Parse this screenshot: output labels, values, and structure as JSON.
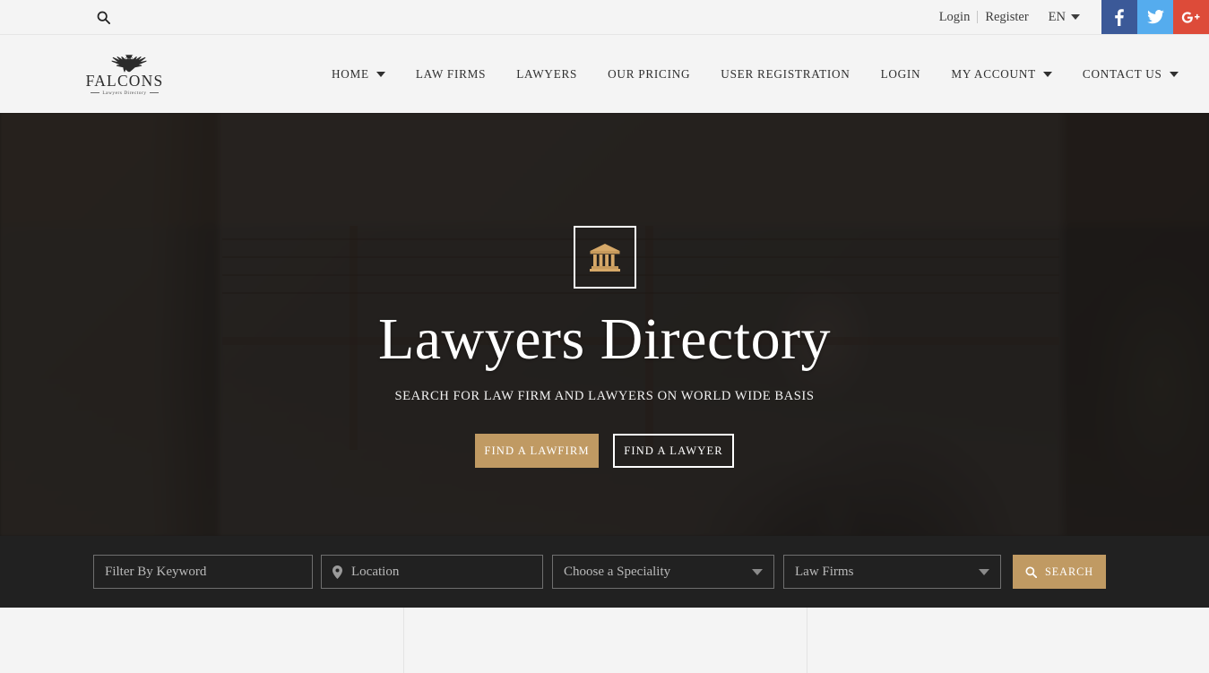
{
  "topbar": {
    "search_icon": "search-icon",
    "login_label": "Login",
    "register_label": "Register",
    "language_label": "EN",
    "social": [
      {
        "name": "facebook",
        "glyph": "f",
        "color": "#3b5998"
      },
      {
        "name": "twitter",
        "glyph": "t",
        "color": "#55acee"
      },
      {
        "name": "google-plus",
        "glyph": "G+",
        "color": "#dd4b39"
      }
    ]
  },
  "header": {
    "logo": {
      "name": "FALCONS",
      "tagline": "Lawyers Directory",
      "icon": "falcon-eagle-icon"
    },
    "nav": [
      {
        "label": "HOME",
        "has_dropdown": true
      },
      {
        "label": "LAW FIRMS",
        "has_dropdown": false
      },
      {
        "label": "LAWYERS",
        "has_dropdown": false
      },
      {
        "label": "OUR PRICING",
        "has_dropdown": false
      },
      {
        "label": "USER REGISTRATION",
        "has_dropdown": false
      },
      {
        "label": "LOGIN",
        "has_dropdown": false
      },
      {
        "label": "MY ACCOUNT",
        "has_dropdown": true
      },
      {
        "label": "CONTACT US",
        "has_dropdown": true
      }
    ]
  },
  "hero": {
    "icon": "bank-courthouse-icon",
    "title": "Lawyers Directory",
    "subtitle": "SEARCH FOR LAW FIRM AND LAWYERS ON WORLD WIDE BASIS",
    "primary_button": "FIND A LAWFIRM",
    "secondary_button": "FIND A LAWYER",
    "accent_color": "#c09a63",
    "overlay_color": "#141211"
  },
  "search": {
    "keyword_placeholder": "Filter By Keyword",
    "keyword_value": "",
    "location_placeholder": "Location",
    "location_value": "",
    "location_icon": "map-pin-icon",
    "speciality_selected": "Choose a Speciality",
    "type_selected": "Law Firms",
    "search_button": "SEARCH",
    "search_button_icon": "search-icon",
    "strip_color": "#212121"
  }
}
